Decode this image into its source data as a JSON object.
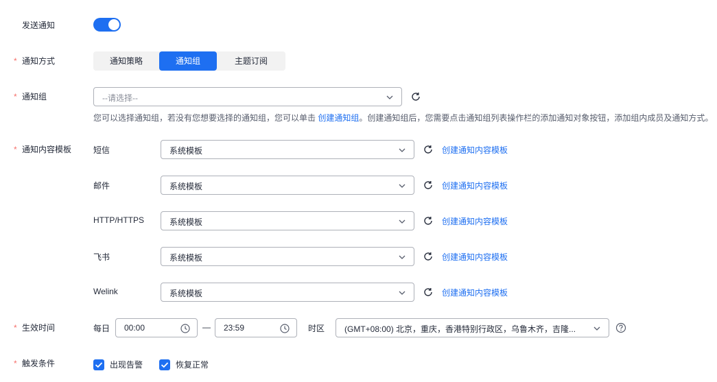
{
  "labels": {
    "send_notify": "发送通知",
    "notify_method": "通知方式",
    "notify_group": "通知组",
    "content_template": "通知内容模板",
    "effective_time": "生效时间",
    "trigger_condition": "触发条件",
    "required_mark": "*"
  },
  "send_notify_enabled": true,
  "method_tabs": [
    {
      "label": "通知策略",
      "active": false
    },
    {
      "label": "通知组",
      "active": true
    },
    {
      "label": "主题订阅",
      "active": false
    }
  ],
  "notify_group_select": {
    "placeholder": "--请选择--"
  },
  "hint": {
    "before": "您可以选择通知组，若没有您想要选择的通知组，您可以单击 ",
    "link": "创建通知组",
    "after": "。创建通知组后，您需要点击通知组列表操作栏的添加通知对象按钮，添加组内成员及通知方式。"
  },
  "templates": [
    {
      "channel": "短信",
      "value": "系统模板",
      "link": "创建通知内容模板"
    },
    {
      "channel": "邮件",
      "value": "系统模板",
      "link": "创建通知内容模板"
    },
    {
      "channel": "HTTP/HTTPS",
      "value": "系统模板",
      "link": "创建通知内容模板"
    },
    {
      "channel": "飞书",
      "value": "系统模板",
      "link": "创建通知内容模板"
    },
    {
      "channel": "Welink",
      "value": "系统模板",
      "link": "创建通知内容模板"
    }
  ],
  "effective": {
    "daily_label": "每日",
    "start": "00:00",
    "dash": "—",
    "end": "23:59",
    "timezone_label": "时区",
    "timezone": "(GMT+08:00) 北京，重庆，香港特别行政区，乌鲁木齐，吉隆..."
  },
  "triggers": [
    {
      "label": "出现告警",
      "checked": true
    },
    {
      "label": "恢复正常",
      "checked": true
    }
  ],
  "colors": {
    "accent": "#1e6ff1",
    "required": "#f66f6a"
  }
}
